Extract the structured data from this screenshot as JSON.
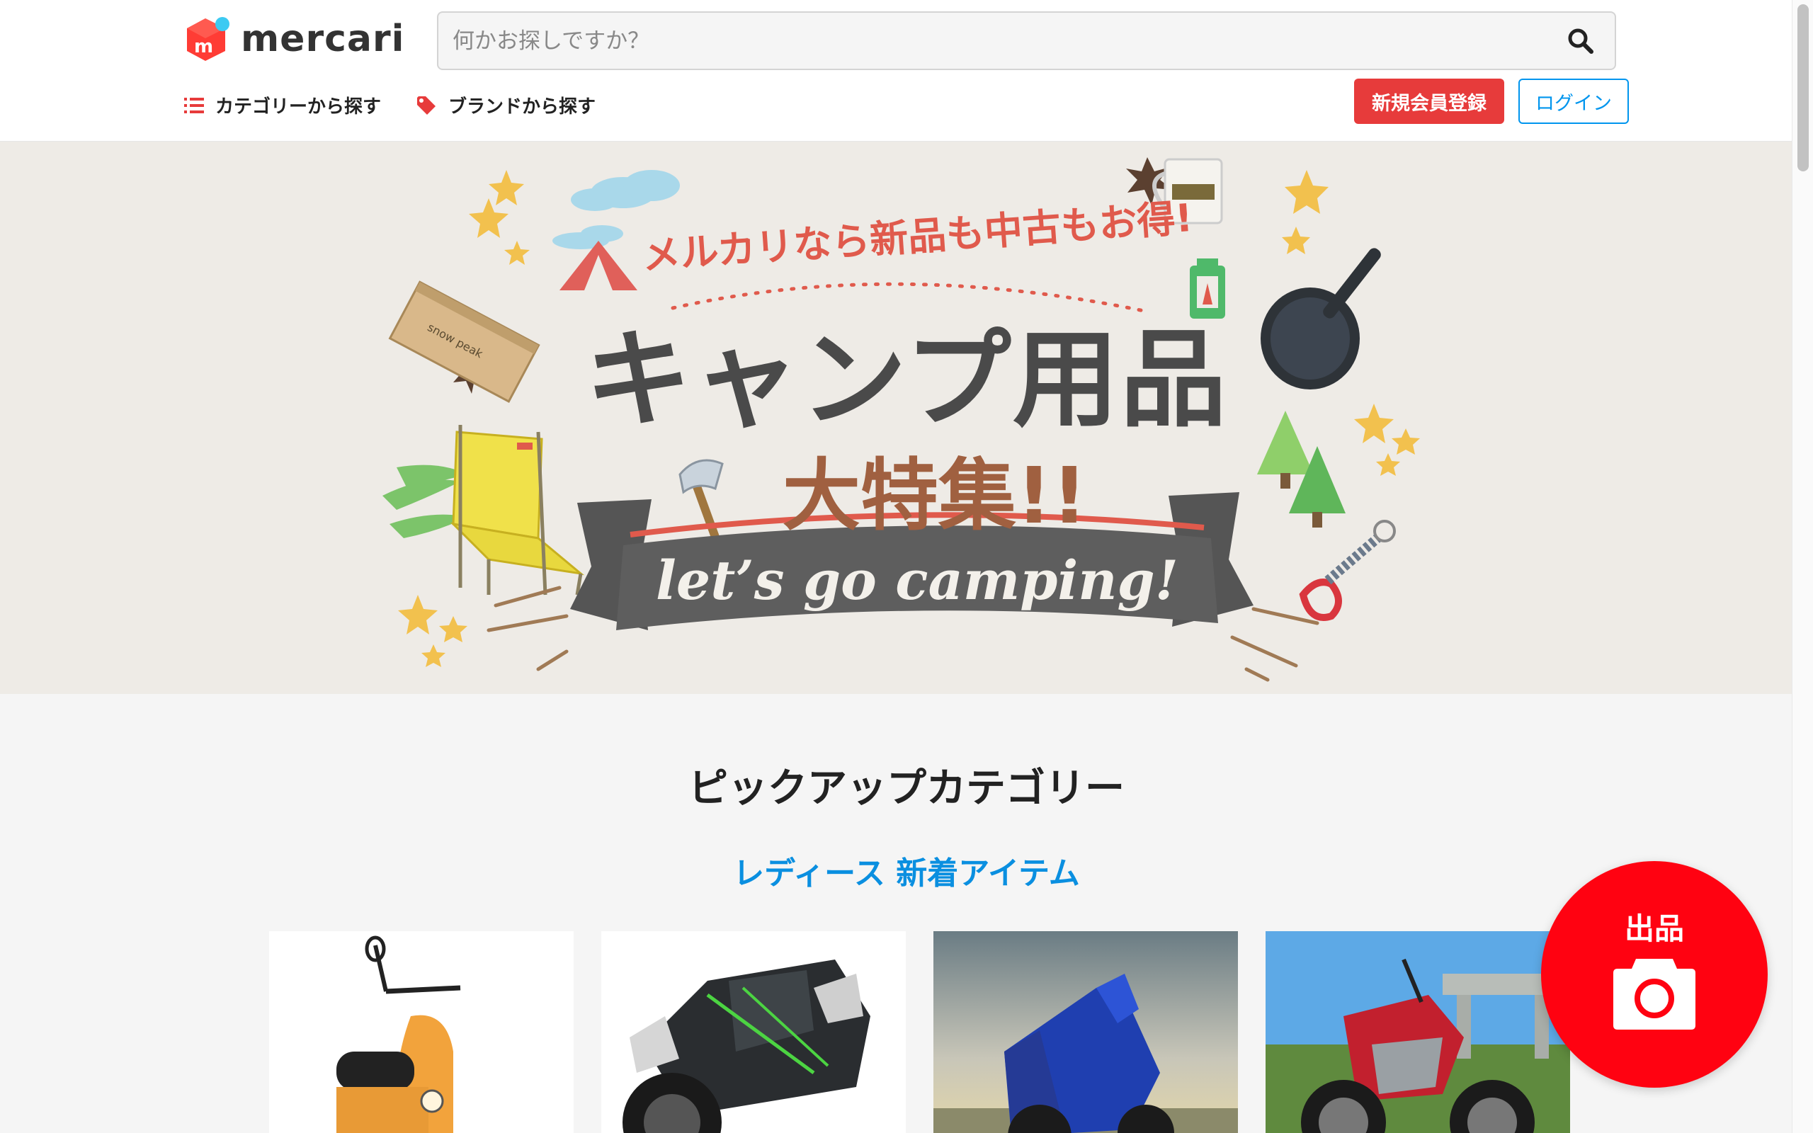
{
  "header": {
    "logo_text": "mercari",
    "search": {
      "placeholder": "何かお探しですか？",
      "value": ""
    },
    "nav": {
      "category_label": "カテゴリーから探す",
      "brand_label": "ブランドから探す"
    },
    "signup_label": "新規会員登録",
    "login_label": "ログイン"
  },
  "banner": {
    "tagline": "メルカリなら新品も中古もお得!",
    "title_line1": "キャンプ用品",
    "title_line2": "大特集!!",
    "ribbon_text": "let’s go camping!",
    "box_label": "snow peak",
    "colors": {
      "background": "#eeebe6",
      "title": "#4a4a4a",
      "accent": "#e05a4c",
      "ribbon": "#5a5a5a"
    }
  },
  "pickup": {
    "title": "ピックアップカテゴリー",
    "subtitle": "レディース 新着アイテム",
    "items": [
      {
        "name": "orange-scooter"
      },
      {
        "name": "black-sport-motorcycle"
      },
      {
        "name": "blue-sport-motorcycle"
      },
      {
        "name": "red-naked-motorcycle"
      }
    ]
  },
  "sell_button": {
    "label": "出品"
  },
  "colors": {
    "brand_red": "#ff0211",
    "link_blue": "#0095ee",
    "signup_red": "#e73b3b"
  }
}
